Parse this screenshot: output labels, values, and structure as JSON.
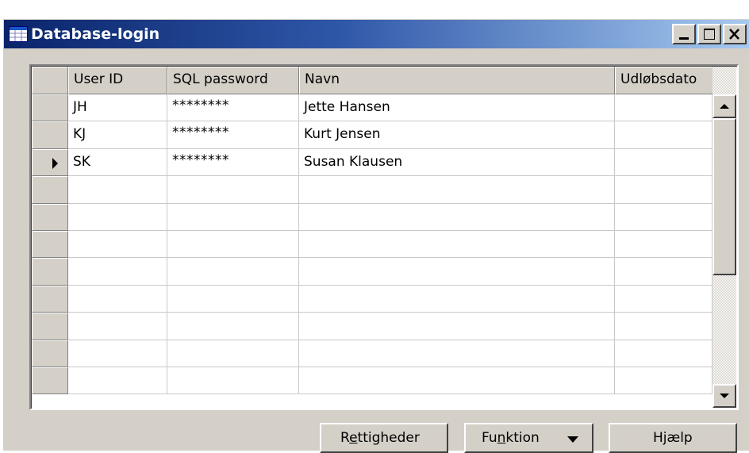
{
  "window": {
    "title": "Database-login",
    "controls": [
      "minimize",
      "maximize",
      "close"
    ]
  },
  "grid": {
    "columns": [
      "User ID",
      "SQL password",
      "Navn",
      "Udløbsdato"
    ],
    "rows": [
      {
        "user_id": "JH",
        "sql_password": "********",
        "navn": "Jette Hansen",
        "udlobsdato": ""
      },
      {
        "user_id": "KJ",
        "sql_password": "********",
        "navn": "Kurt Jensen",
        "udlobsdato": ""
      },
      {
        "user_id": "SK",
        "sql_password": "********",
        "navn": "Susan Klausen",
        "udlobsdato": ""
      }
    ],
    "current_row_index": 2,
    "empty_row_count": 8
  },
  "buttons": {
    "rettigheder": {
      "before": "R",
      "mnemonic": "e",
      "after": "ttigheder"
    },
    "funktion": {
      "before": "Fu",
      "mnemonic": "n",
      "after": "ktion"
    },
    "hjaelp": "Hjælp"
  },
  "icons": {
    "app": "table-grid-icon",
    "row_indicator": "current-row-arrow-icon",
    "dropdown": "triangle-down-icon",
    "scroll_up": "arrow-up-icon",
    "scroll_down": "arrow-down-icon"
  }
}
